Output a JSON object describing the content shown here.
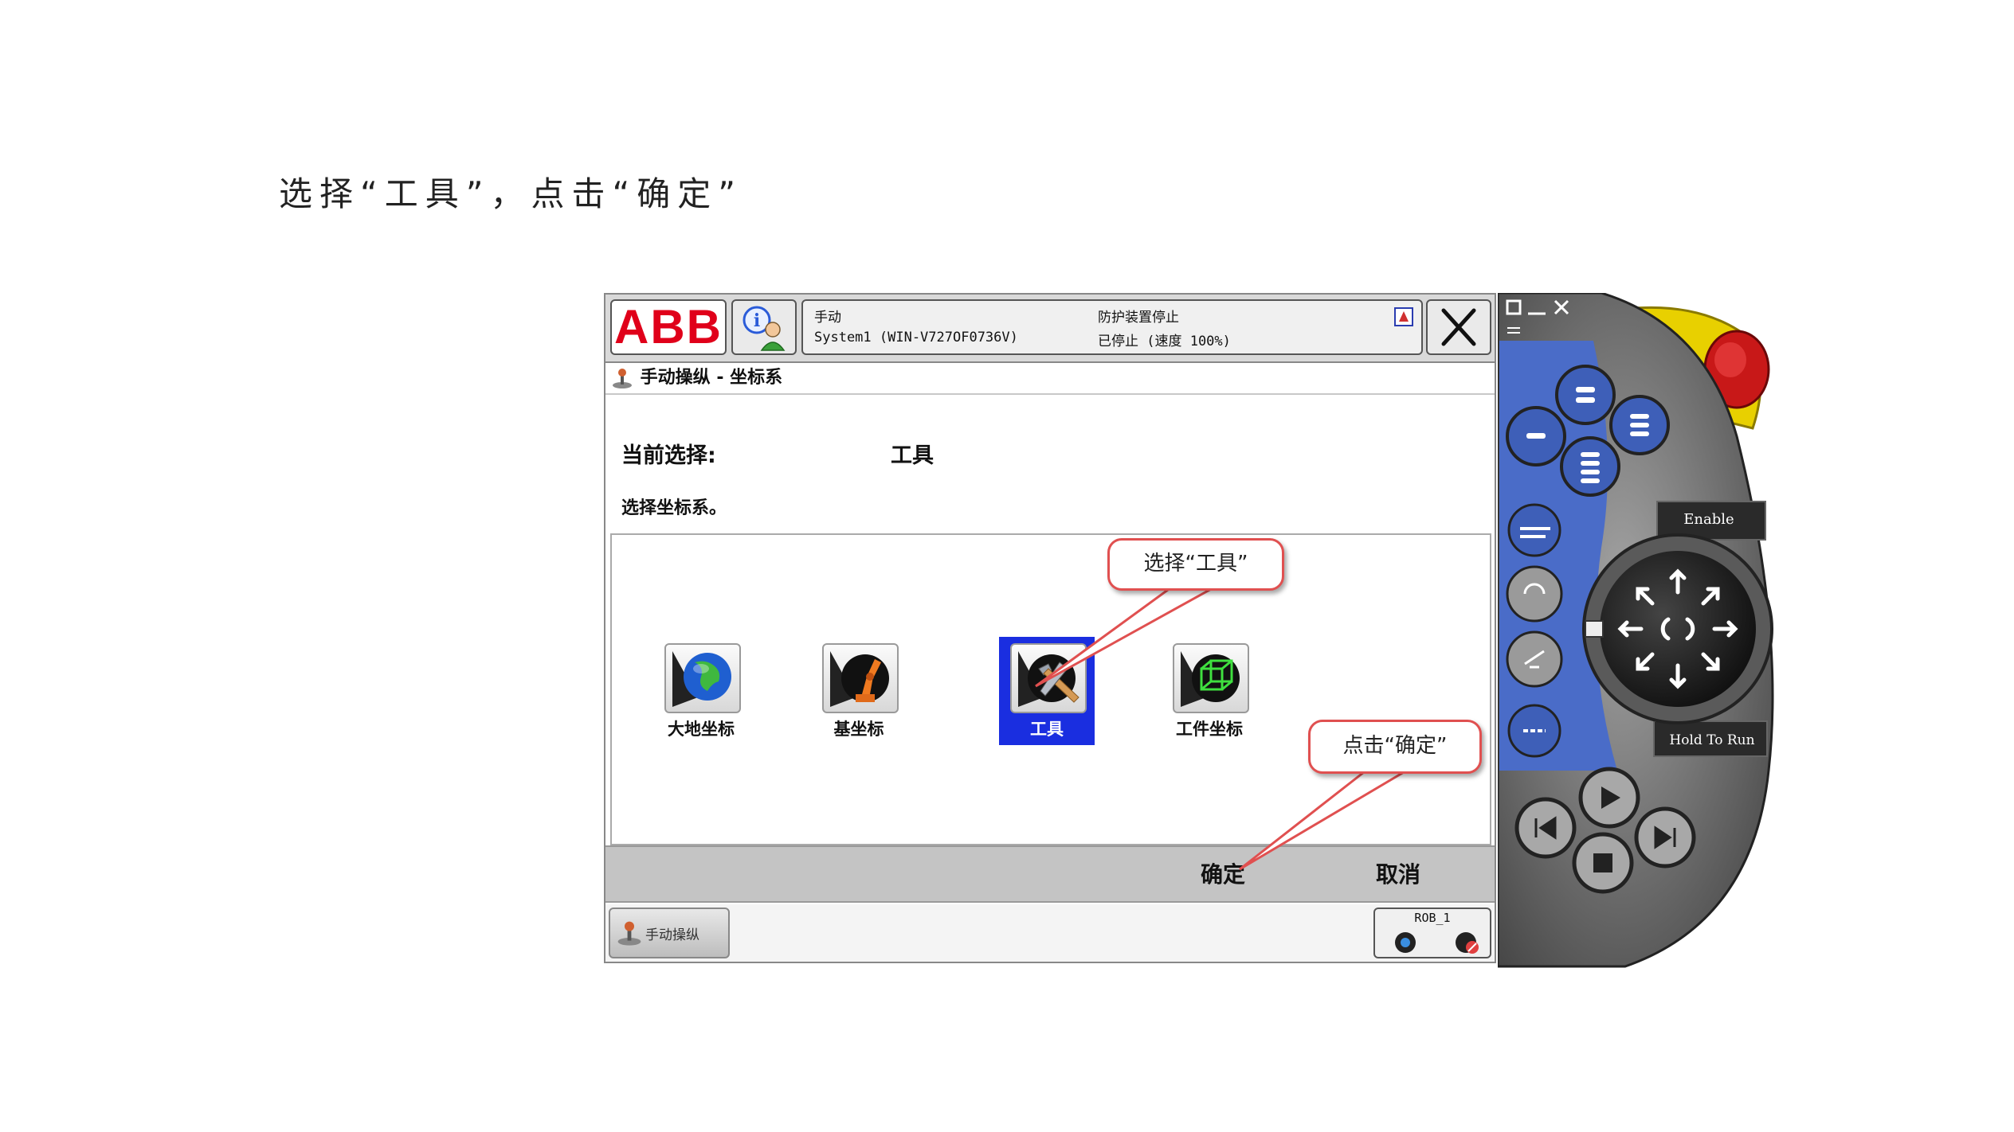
{
  "instruction": "选择“工具”，点击“确定”",
  "header": {
    "mode": "手动",
    "system": "System1 (WIN-V727OF0736V)",
    "guard": "防护装置停止",
    "state": "已停止 (速度 100%)",
    "logo": "ABB"
  },
  "breadcrumb": "手动操纵 - 坐标系",
  "current": {
    "label": "当前选择:",
    "value": "工具"
  },
  "hint": "选择坐标系。",
  "frames": [
    {
      "label": "大地坐标",
      "icon": "globe-icon"
    },
    {
      "label": "基坐标",
      "icon": "robot-arm-icon"
    },
    {
      "label": "工具",
      "icon": "hammer-icon",
      "selected": true
    },
    {
      "label": "工件坐标",
      "icon": "wireframe-cube-icon"
    }
  ],
  "commands": {
    "ok": "确定",
    "cancel": "取消"
  },
  "taskbar": {
    "jog": "手动操纵",
    "rob": "ROB_1"
  },
  "callouts": {
    "select_tool": "选择“工具”",
    "click_ok": "点击“确定”"
  },
  "pendant": {
    "enable": "Enable",
    "hold_to_run": "Hold To Run"
  },
  "colors": {
    "abb_red": "#e0001a",
    "selection_blue": "#1a2ee0",
    "callout_border": "#e05050",
    "pendant_blue": "#4a6cc8"
  }
}
